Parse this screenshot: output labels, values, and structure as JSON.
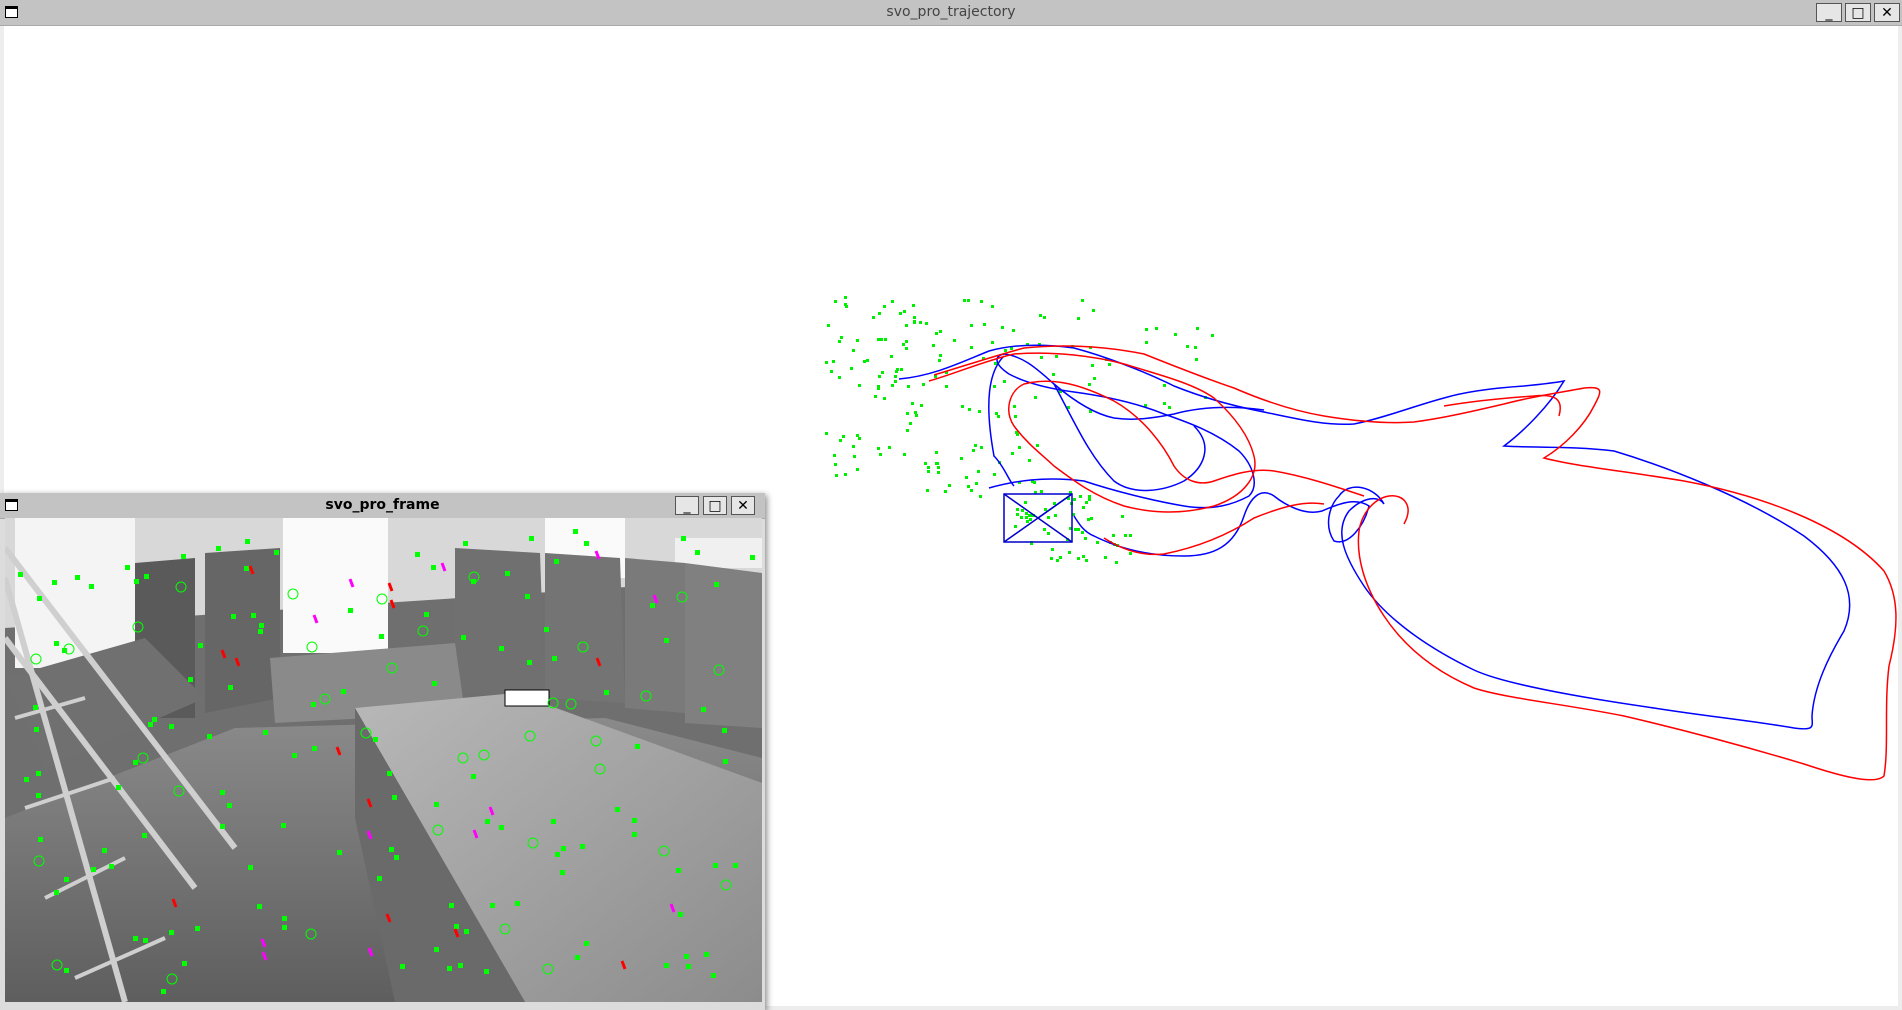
{
  "trajectory_window": {
    "title": "svo_pro_trajectory",
    "buttons": {
      "minimize": "_",
      "maximize": "□",
      "close": "✕"
    },
    "icons": {
      "window": "window-icon"
    }
  },
  "frame_window": {
    "title": "svo_pro_frame",
    "buttons": {
      "minimize": "_",
      "maximize": "□",
      "close": "✕"
    },
    "icons": {
      "window": "window-icon"
    }
  },
  "colors": {
    "estimate_trajectory": "#ff0000",
    "groundtruth_trajectory": "#0000ff",
    "landmarks": "#00ee00",
    "camera_frustum": "#0000cc",
    "feature_corner": "#00ff00",
    "feature_edgelet": "#ff00ff",
    "feature_gradient": "#ff0000"
  }
}
